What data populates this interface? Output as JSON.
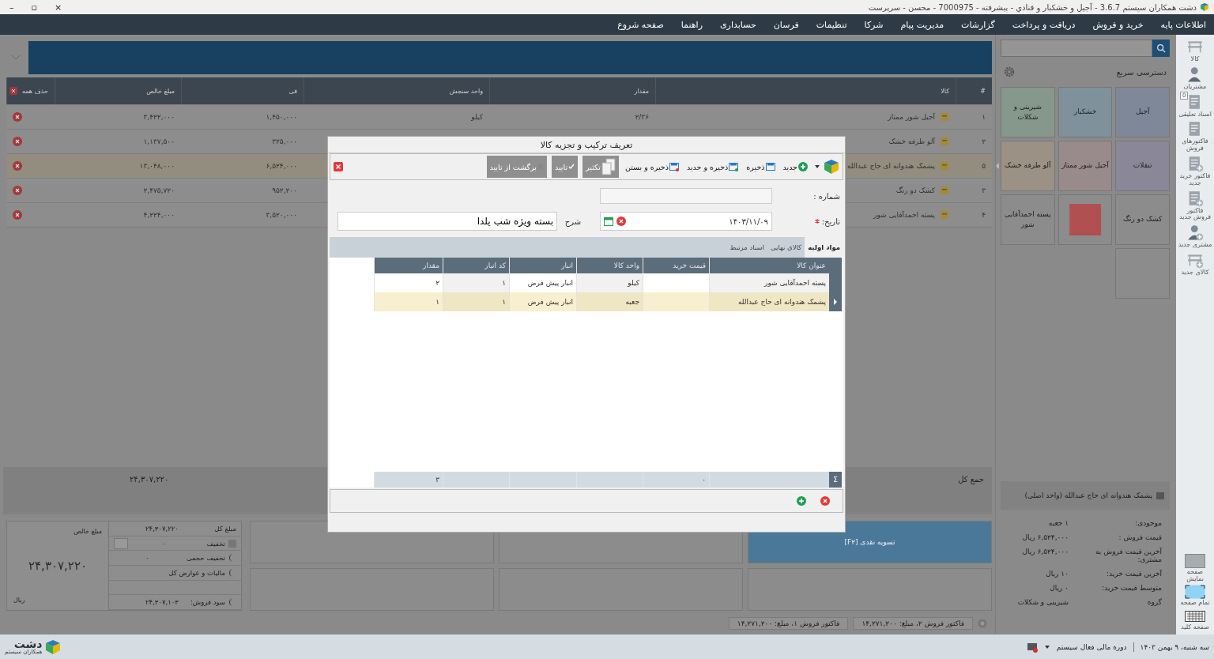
{
  "window": {
    "title": "دشت همکاران سیستم 3.6.7 - آجیل و خشکبار و قنادي - پیشرفته - 7000975 - محسن - سرپرست",
    "controls": [
      "×",
      "▫",
      "–"
    ]
  },
  "menu": [
    "اطلاعات پایه",
    "خرید و فروش",
    "دریافت و پرداخت",
    "گزارشات",
    "مدیریت پیام",
    "شرکا",
    "تنظیمات",
    "فرسان",
    "حسابداری",
    "راهنما",
    "صفحه شروع"
  ],
  "invoice_table": {
    "columns": [
      "#",
      "کالا",
      "مقدار",
      "واحد سنجش",
      "فی",
      "مبلغ خالص",
      "حذف همه"
    ],
    "rows": [
      {
        "number": "۱",
        "item": "آجیل شور ممتاز",
        "quantity": "۲/۳۶",
        "unit": "کیلو",
        "price": "۱,۴۵۰,۰۰۰",
        "total": "۳,۴۲۲,۰۰۰",
        "selected": false
      },
      {
        "number": "۲",
        "item": "آلو طرفه خشک",
        "price": "۳۲۵,۰۰۰",
        "total": "۱,۱۳۷,۵۰۰",
        "selected": false
      },
      {
        "number": "۵",
        "item": "پشمک هندوانه ای حاج عبدالله",
        "price": "۶,۵۲۴,۰۰۰",
        "total": "۱۳,۰۴۸,۰۰۰",
        "selected": true
      },
      {
        "number": "۳",
        "item": "کشک دو رنگ",
        "price": "۹۵۲,۲۰۰",
        "total": "۲,۴۷۵,۷۲۰",
        "selected": false
      },
      {
        "number": "۴",
        "item": "پسته احمدآقایی شور",
        "price": "۳,۵۲۰,۰۰۰",
        "total": "۴,۲۲۴,۰۰۰",
        "selected": false
      }
    ]
  },
  "grand_total": {
    "label": "جمع کل",
    "value": "۲۴,۳۰۷,۲۲۰"
  },
  "summary": {
    "net_label": "مبلغ خالص",
    "net_value": "۲۴,۳۰۷,۲۲۰",
    "currency": "ریال",
    "rows": [
      {
        "kind": "plain",
        "label": "مبلغ کل",
        "value": "۲۴,۳۰۷,۲۲۰"
      },
      {
        "kind": "discount",
        "label": "تخفیف",
        "value": "۰"
      },
      {
        "kind": "toggle",
        "label": "تخفیف حجمی",
        "value": "۰"
      },
      {
        "kind": "toggle",
        "label": "مالیات و عوارض کل"
      },
      {
        "kind": "empty"
      },
      {
        "kind": "toggle",
        "label": "سود فروش:",
        "value": "۲۴,۳۰۷,۱۰۳"
      }
    ]
  },
  "actions": [
    {
      "label": "تسویه نقدی [F۲]",
      "primary": true
    },
    {
      "primary": false
    },
    {
      "primary": false
    },
    {
      "primary": false
    },
    {
      "primary": false
    },
    {
      "primary": false
    }
  ],
  "open_invoices": [
    "فاکتور فروش ۲، مبلغ: ۱۴,۲۷۱,۲۰۰",
    "فاکتور فروش ۱، مبلغ: ۱۴,۲۷۱,۲۰۰"
  ],
  "quick_access": {
    "title": "دسترسی سریع",
    "tiles": [
      {
        "kind": "text",
        "label": "آجیل",
        "color": "#7e8898"
      },
      {
        "kind": "text",
        "label": "خشکبار",
        "color": "#7f929c"
      },
      {
        "kind": "text",
        "label": "شیرینی و شکلات",
        "color": "#86988b"
      },
      {
        "kind": "text",
        "label": "تنقلات",
        "color": "#8a8799"
      },
      {
        "kind": "text",
        "label": "آجیل شور ممتاز",
        "color": "#998a8c"
      },
      {
        "kind": "text",
        "label": "آلو طرفه خشک",
        "color": "#9b9184"
      },
      {
        "kind": "text",
        "label": "کشک دو رنگ",
        "color": "#8c8c8c"
      },
      {
        "kind": "photo",
        "color": "#8c8c8c"
      },
      {
        "kind": "text",
        "label": "پسته احمدآقایی شور",
        "color": "#8c8c8c"
      },
      {
        "kind": "text",
        "color": "#8c8c8c"
      }
    ]
  },
  "item_info": {
    "title": "پشمک هندوانه ای حاج عبدالله (واحد اصلی)",
    "rows": [
      {
        "label": "موجودی:",
        "value": "۱ جعبه"
      },
      {
        "label": "قیمت فروش :",
        "value": "۶,۵۲۴,۰۰۰ ریال"
      },
      {
        "label": "آخرین قیمت فروش به مشتری:",
        "value": "۶,۵۲۴,۰۰۰ ریال"
      },
      {
        "label": "آخرین قیمت خرید:",
        "value": "۱۰ ریال"
      },
      {
        "label": "متوسط قیمت خرید:",
        "value": "۰ ریال"
      },
      {
        "label": "گروه",
        "value": "شیرینی و شکلات"
      }
    ]
  },
  "sidebar": {
    "top": [
      {
        "kind": "goods",
        "label": "کالا"
      },
      {
        "kind": "person",
        "label": "مشتریان"
      },
      {
        "kind": "doc",
        "label": "اسناد تعلیقی",
        "badge": "0"
      },
      {
        "kind": "doc",
        "label": "فاکتورهای فروش"
      },
      {
        "kind": "doc-add",
        "label": "فاکتور خرید جدید"
      },
      {
        "kind": "doc-add",
        "label": "فاکتور فروش جدید"
      },
      {
        "kind": "person-add",
        "label": "مشتری جدید"
      },
      {
        "kind": "goods-add",
        "label": "کالای جدید"
      }
    ],
    "bottom": [
      {
        "kind": "screen",
        "label": "صفحه نمایش"
      },
      {
        "kind": "fullscreen",
        "label": "تمام صفحه"
      },
      {
        "kind": "keyboard",
        "label": "صفحه کلید"
      }
    ]
  },
  "status_bar": {
    "date": "سه شنبه، ۹ بهمن ۱۴۰۳",
    "period": "دوره مالی فعال سیستم",
    "logo_name": "دشت",
    "logo_tagline": "همکاران سیستم"
  },
  "dialog": {
    "title": "تعریف ترکیب و تجزیه کالا",
    "toolbar": [
      {
        "kind": "new",
        "label": "جدید",
        "disabled": false
      },
      {
        "kind": "save",
        "label": "ذخیره",
        "disabled": false
      },
      {
        "kind": "save-new",
        "label": "ذخیره و جدید",
        "disabled": false
      },
      {
        "kind": "save-close",
        "label": "ذخیره و بستن",
        "disabled": false
      },
      {
        "kind": "copy",
        "label": "تکثیر",
        "disabled": true
      },
      {
        "kind": "confirm",
        "label": "تایید",
        "disabled": true
      },
      {
        "kind": "unconfirm",
        "label": "برگشت از تایید",
        "disabled": true
      }
    ],
    "number_label": "شماره :",
    "date_label": "تاریخ:",
    "date_required": true,
    "date_value": "۱۴۰۳/۱۱/۰۹",
    "description_label": "شرح",
    "description_value": "بسته ویژه شب یلدا",
    "tabs": [
      {
        "label": "مواد اولیه",
        "selected": true
      },
      {
        "label": "کالای نهایی",
        "selected": false
      },
      {
        "label": "اسناد مرتبط",
        "selected": false
      }
    ],
    "grid": {
      "columns": [
        "عنوان کالا",
        "قیمت خرید",
        "واحد کالا",
        "انبار",
        "کد انبار",
        "مقدار"
      ],
      "rows": [
        {
          "cells": [
            "پسته احمدآقایی شور",
            null,
            "کیلو",
            "انبار پیش فرض",
            "۱",
            "۲"
          ],
          "selected": false
        },
        {
          "cells": [
            "پشمک هندوانه ای حاج عبدالله",
            null,
            "جعبه",
            "انبار پیش فرض",
            "۱",
            "۱"
          ],
          "selected": true
        }
      ],
      "sum_symbol": "Σ",
      "totals": {
        "purchase_price": "۰",
        "quantity": "۳"
      }
    }
  }
}
